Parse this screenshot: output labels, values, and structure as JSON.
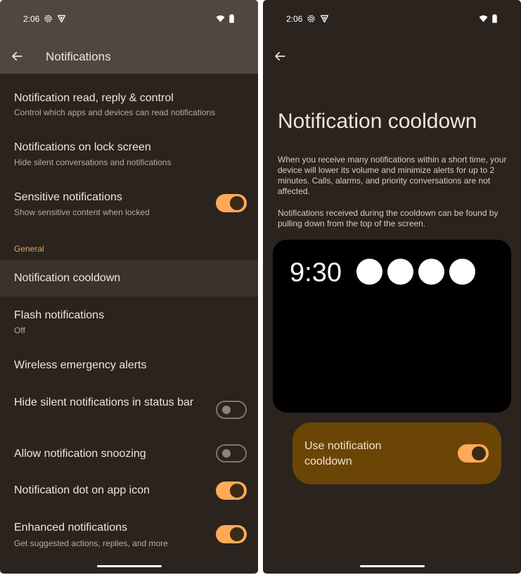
{
  "status_bar": {
    "time": "2:06"
  },
  "left_screen": {
    "header": {
      "title": "Notifications"
    },
    "items": [
      {
        "title": "Notification read, reply & control",
        "subtitle": "Control which apps and devices can read notifications"
      },
      {
        "title": "Notifications on lock screen",
        "subtitle": "Hide silent conversations and notifications"
      },
      {
        "title": "Sensitive notifications",
        "subtitle": "Show sensitive content when locked",
        "toggle": "on"
      }
    ],
    "section_label": "General",
    "general_items": [
      {
        "title": "Notification cooldown"
      },
      {
        "title": "Flash notifications",
        "subtitle": "Off"
      },
      {
        "title": "Wireless emergency alerts"
      },
      {
        "title": "Hide silent notifications in status bar",
        "toggle": "off"
      },
      {
        "title": "Allow notification snoozing",
        "toggle": "off"
      },
      {
        "title": "Notification dot on app icon",
        "toggle": "on"
      },
      {
        "title": "Enhanced notifications",
        "subtitle": "Get suggested actions, replies, and more",
        "toggle": "on"
      }
    ]
  },
  "right_screen": {
    "title": "Notification cooldown",
    "description_1": "When you receive many notifications within a short time, your device will lower its volume and minimize alerts for up to 2 minutes. Calls, alarms, and priority conversations are not affected.",
    "description_2": "Notifications received during the cooldown can be found by pulling down from the top of the screen.",
    "preview": {
      "clock": "9:30"
    },
    "use_toggle": {
      "label": "Use notification cooldown",
      "state": "on"
    }
  },
  "colors": {
    "background": "#2a231e",
    "header": "#514740",
    "accent": "#ffaa57",
    "section": "#e8a15c",
    "card": "#6b4506"
  }
}
